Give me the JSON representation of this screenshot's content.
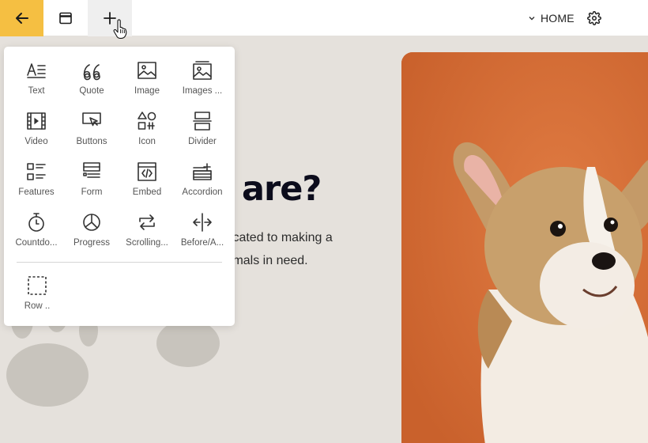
{
  "topbar": {
    "back_icon": "arrow-left-icon",
    "window_icon": "browser-window-icon",
    "add_icon": "plus-icon",
    "nav_label": "HOME",
    "nav_icon": "chevron-down-icon",
    "settings_icon": "gear-icon",
    "accent_color": "#f5bf42"
  },
  "page": {
    "headline": "are?",
    "paragraph_line1": "dicated to making a",
    "paragraph_line2": "nimals in need."
  },
  "block_menu": {
    "items": [
      {
        "label": "Text",
        "icon": "text-icon"
      },
      {
        "label": "Quote",
        "icon": "quote-icon"
      },
      {
        "label": "Image",
        "icon": "image-icon"
      },
      {
        "label": "Images ...",
        "icon": "images-icon"
      },
      {
        "label": "Video",
        "icon": "video-icon"
      },
      {
        "label": "Buttons",
        "icon": "buttons-icon"
      },
      {
        "label": "Icon",
        "icon": "shapes-icon"
      },
      {
        "label": "Divider",
        "icon": "divider-icon"
      },
      {
        "label": "Features",
        "icon": "features-icon"
      },
      {
        "label": "Form",
        "icon": "form-icon"
      },
      {
        "label": "Embed",
        "icon": "embed-icon"
      },
      {
        "label": "Accordion",
        "icon": "accordion-icon"
      },
      {
        "label": "Countdo...",
        "icon": "timer-icon"
      },
      {
        "label": "Progress",
        "icon": "pie-chart-icon"
      },
      {
        "label": "Scrolling...",
        "icon": "repeat-icon"
      },
      {
        "label": "Before/A...",
        "icon": "compare-arrows-icon"
      }
    ],
    "row_item": {
      "label": "Row ..",
      "icon": "dashed-square-icon"
    }
  }
}
